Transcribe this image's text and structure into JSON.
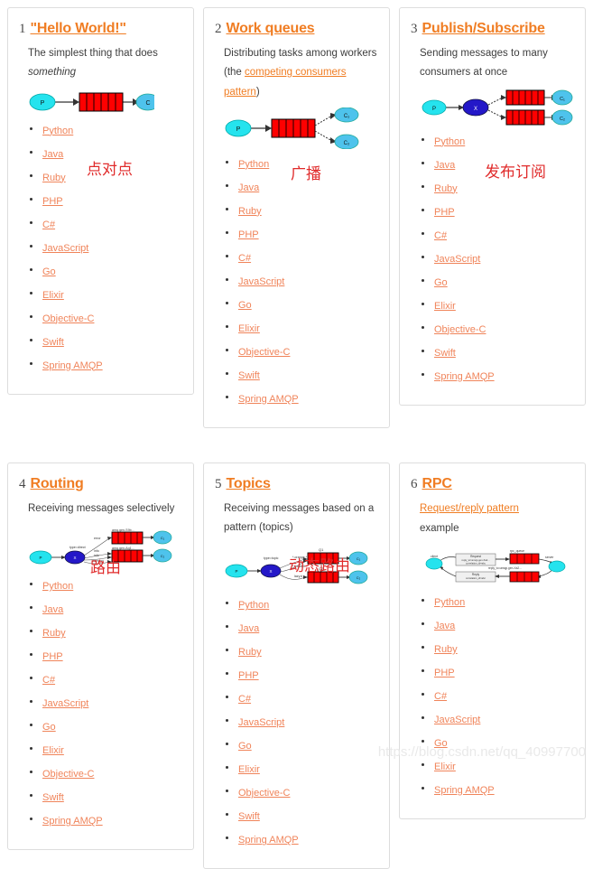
{
  "page": {
    "watermark": "https://blog.csdn.net/qq_40997700"
  },
  "languages_full": [
    "Python",
    "Java",
    "Ruby",
    "PHP",
    "C#",
    "JavaScript",
    "Go",
    "Elixir",
    "Objective-C",
    "Swift",
    "Spring AMQP"
  ],
  "languages_short": [
    "Python",
    "Java",
    "Ruby",
    "PHP",
    "C#",
    "JavaScript",
    "Go",
    "Elixir",
    "Spring AMQP"
  ],
  "tutorials": [
    {
      "number": "1",
      "title": "\"Hello World!\"",
      "desc_parts": [
        {
          "text": "The simplest thing that does ",
          "style": "plain"
        },
        {
          "text": "something",
          "style": "italic"
        }
      ],
      "cn_note": "点对点",
      "diagram": "hello-world-diagram",
      "languages": [
        "Python",
        "Java",
        "Ruby",
        "PHP",
        "C#",
        "JavaScript",
        "Go",
        "Elixir",
        "Objective-C",
        "Swift",
        "Spring AMQP"
      ]
    },
    {
      "number": "2",
      "title": "Work queues",
      "desc_parts": [
        {
          "text": "Distributing tasks among workers (the ",
          "style": "plain"
        },
        {
          "text": "competing consumers pattern",
          "style": "link"
        },
        {
          "text": ")",
          "style": "plain"
        }
      ],
      "cn_note": "广播",
      "diagram": "work-queues-diagram",
      "languages": [
        "Python",
        "Java",
        "Ruby",
        "PHP",
        "C#",
        "JavaScript",
        "Go",
        "Elixir",
        "Objective-C",
        "Swift",
        "Spring AMQP"
      ]
    },
    {
      "number": "3",
      "title": "Publish/Subscribe",
      "desc_parts": [
        {
          "text": "Sending messages to many consumers at once",
          "style": "plain"
        }
      ],
      "cn_note": "发布订阅",
      "diagram": "publish-subscribe-diagram",
      "languages": [
        "Python",
        "Java",
        "Ruby",
        "PHP",
        "C#",
        "JavaScript",
        "Go",
        "Elixir",
        "Objective-C",
        "Swift",
        "Spring AMQP"
      ]
    },
    {
      "number": "4",
      "title": "Routing",
      "desc_parts": [
        {
          "text": "Receiving messages selectively",
          "style": "plain"
        }
      ],
      "cn_note": "路由",
      "diagram": "routing-diagram",
      "languages": [
        "Python",
        "Java",
        "Ruby",
        "PHP",
        "C#",
        "JavaScript",
        "Go",
        "Elixir",
        "Objective-C",
        "Swift",
        "Spring AMQP"
      ]
    },
    {
      "number": "5",
      "title": "Topics",
      "desc_parts": [
        {
          "text": "Receiving messages based on a pattern (topics)",
          "style": "plain"
        }
      ],
      "cn_note": "动态路由",
      "diagram": "topics-diagram",
      "languages": [
        "Python",
        "Java",
        "Ruby",
        "PHP",
        "C#",
        "JavaScript",
        "Go",
        "Elixir",
        "Objective-C",
        "Swift",
        "Spring AMQP"
      ]
    },
    {
      "number": "6",
      "title": "RPC",
      "desc_parts": [
        {
          "text": "Request/reply pattern",
          "style": "link"
        },
        {
          "text": " example",
          "style": "plain"
        }
      ],
      "cn_note": "",
      "diagram": "rpc-diagram",
      "languages": [
        "Python",
        "Java",
        "Ruby",
        "PHP",
        "C#",
        "JavaScript",
        "Go",
        "Elixir",
        "Spring AMQP"
      ]
    }
  ],
  "diagram_labels": {
    "producer": "P",
    "consumer": "C",
    "consumer1": "C₁",
    "consumer2": "C₂",
    "exchange": "X",
    "routing_error": "error",
    "routing_info": "info",
    "routing_warning": "warning",
    "routing_type_direct": "type=direct",
    "routing_queue1": "amq.gen-S9b...",
    "routing_queue2": "amq.gen-Ag1...",
    "topics_type": "type=topic",
    "topics_key1": "*.orange.*",
    "topics_key2": "*.*.rabbit",
    "topics_key3": "lazy.#",
    "topics_q1": "Q1",
    "topics_q2": "Q2",
    "rpc_client": "client",
    "rpc_server": "server",
    "rpc_request": "Request",
    "rpc_request_props": "reply_to=amqp.gen-Xa2...\\ncorrelation_id=abc",
    "rpc_reply": "Reply",
    "rpc_reply_props": "correlation_id=abc",
    "rpc_queue": "rpc_queue",
    "rpc_reply_queue": "reply_to=amqp.gen-Xa2..."
  },
  "colors": {
    "title": "#f07d23",
    "link": "#f0845a",
    "annotation": "#e02b2b",
    "producer_fill": "#25e3ee",
    "consumer_fill": "#4ec3ec",
    "exchange_fill": "#2418c8",
    "queue_fill": "#fe0000",
    "card_border": "#dddddd",
    "watermark": "#e9e9e9"
  }
}
